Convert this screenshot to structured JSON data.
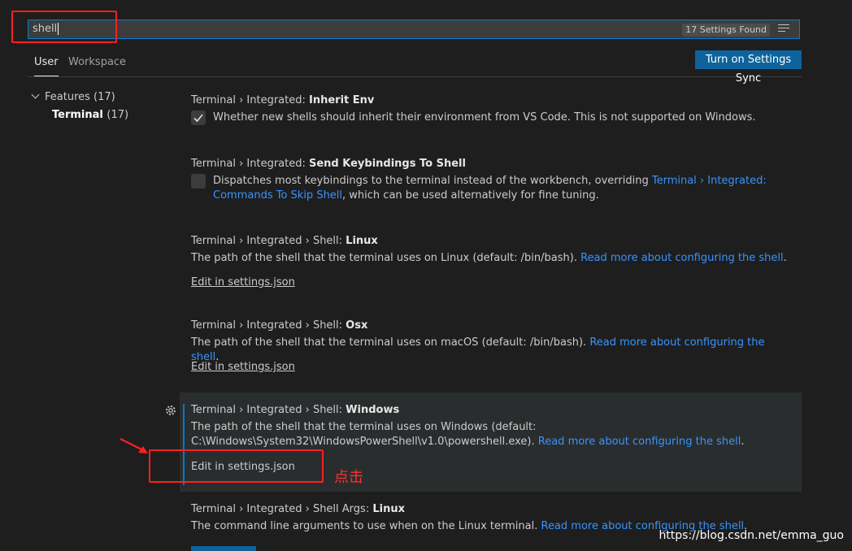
{
  "search": {
    "value": "shell",
    "results_badge": "17 Settings Found"
  },
  "tabs": [
    {
      "label": "User"
    },
    {
      "label": "Workspace"
    }
  ],
  "sync_button": "Turn on Settings Sync",
  "toc": {
    "features_label": "Features",
    "features_count": "(17)",
    "terminal_label": "Terminal",
    "terminal_count": "(17)"
  },
  "settings": [
    {
      "category": "Terminal › Integrated: ",
      "name": "Inherit Env",
      "checked": true,
      "desc": "Whether new shells should inherit their environment from VS Code. This is not supported on Windows."
    },
    {
      "category": "Terminal › Integrated: ",
      "name": "Send Keybindings To Shell",
      "checked": false,
      "desc_pre": "Dispatches most keybindings to the terminal instead of the workbench, overriding ",
      "desc_link": "Terminal › Integrated: Commands To Skip Shell",
      "desc_post": ", which can be used alternatively for fine tuning."
    },
    {
      "category": "Terminal › Integrated › Shell: ",
      "name": "Linux",
      "desc": "The path of the shell that the terminal uses on Linux (default: /bin/bash). ",
      "link": "Read more about configuring the shell",
      "desc_end": ".",
      "edit": "Edit in settings.json"
    },
    {
      "category": "Terminal › Integrated › Shell: ",
      "name": "Osx",
      "desc": "The path of the shell that the terminal uses on macOS (default: /bin/bash). ",
      "link": "Read more about configuring the shell",
      "desc_end": ".",
      "edit": "Edit in settings.json"
    },
    {
      "category": "Terminal › Integrated › Shell: ",
      "name": "Windows",
      "desc_line1": "The path of the shell that the terminal uses on Windows (default:",
      "desc_line2": "C:\\Windows\\System32\\WindowsPowerShell\\v1.0\\powershell.exe). ",
      "link": "Read more about configuring the shell",
      "desc_end": ".",
      "edit": "Edit in settings.json"
    },
    {
      "category": "Terminal › Integrated › Shell Args: ",
      "name": "Linux",
      "desc": "The command line arguments to use when on the Linux terminal. ",
      "link": "Read more about configuring the shell",
      "desc_end": "."
    }
  ],
  "annotation": {
    "label": "点击",
    "color": "#ff2020"
  },
  "watermark": "https://blog.csdn.net/emma_guo",
  "colors": {
    "accent": "#007fd4",
    "button": "#0e639c",
    "link": "#3794ff",
    "bg": "#1e1e1e"
  }
}
